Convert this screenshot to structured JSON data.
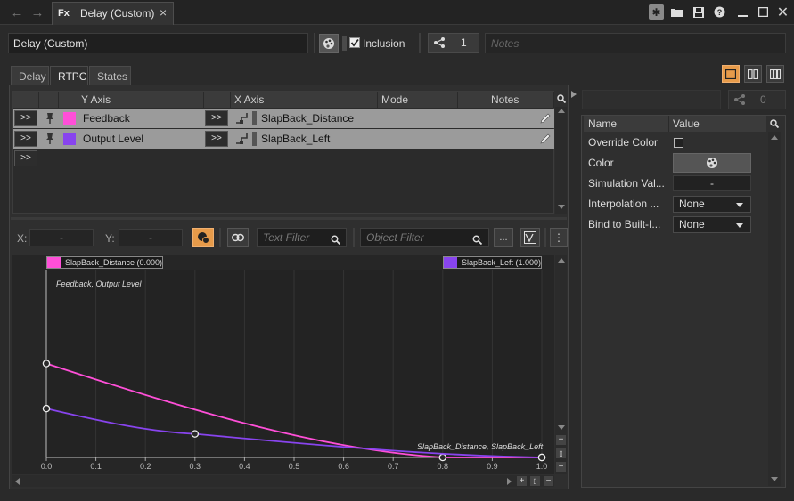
{
  "titlebar": {
    "tab_title": "Delay (Custom)",
    "tab_icon": "Fx",
    "close_glyph": "×"
  },
  "toolbar": {
    "name_value": "Delay (Custom)",
    "inclusion_label": "Inclusion",
    "inclusion_checked": true,
    "share_count": "1",
    "notes_placeholder": "Notes"
  },
  "tabs": [
    {
      "label": "Delay",
      "active": false
    },
    {
      "label": "RTPC",
      "active": true
    },
    {
      "label": "States",
      "active": false
    }
  ],
  "rtpc_table": {
    "headers": {
      "y_axis": "Y Axis",
      "x_axis": "X Axis",
      "mode": "Mode",
      "notes": "Notes"
    },
    "btn_label": ">>",
    "rows": [
      {
        "y_label": "Feedback",
        "y_color": "#ff4fd8",
        "x_label": "SlapBack_Distance"
      },
      {
        "y_label": "Output Level",
        "y_color": "#8844ee",
        "x_label": "SlapBack_Left"
      }
    ]
  },
  "graph_toolbar": {
    "x_label": "X:",
    "x_value": "-",
    "y_label": "Y:",
    "y_value": "-",
    "text_filter_placeholder": "Text Filter",
    "object_filter_placeholder": "Object Filter",
    "more_label": "..."
  },
  "right_panel": {
    "share_count": "0",
    "headers": {
      "name": "Name",
      "value": "Value"
    },
    "properties": [
      {
        "name": "Override Color",
        "kind": "checkbox"
      },
      {
        "name": "Color",
        "kind": "color"
      },
      {
        "name": "Simulation Val...",
        "kind": "text",
        "value": "-"
      },
      {
        "name": "Interpolation ...",
        "kind": "combo",
        "value": "None"
      },
      {
        "name": "Bind to Built-I...",
        "kind": "combo",
        "value": "None"
      }
    ]
  },
  "chart_data": {
    "type": "line",
    "header_left": "SlapBack_Distance (0.000)",
    "header_right": "SlapBack_Left (1.000)",
    "annotation_top": "Feedback, Output Level",
    "annotation_bottom": "SlapBack_Distance, SlapBack_Left",
    "xlim": [
      0,
      1
    ],
    "ylim": [
      0,
      1
    ],
    "x_ticks": [
      "0.0",
      "0.1",
      "0.2",
      "0.3",
      "0.4",
      "0.5",
      "0.6",
      "0.7",
      "0.8",
      "0.9",
      "1.0"
    ],
    "series": [
      {
        "name": "Feedback",
        "color": "#ff4fd8",
        "x": [
          0,
          0.8,
          1.0
        ],
        "y": [
          0.5,
          0.0,
          0.0
        ]
      },
      {
        "name": "Output Level",
        "color": "#8844ee",
        "x": [
          0,
          0.3,
          1.0
        ],
        "y": [
          0.26,
          0.125,
          0.0
        ]
      }
    ]
  }
}
